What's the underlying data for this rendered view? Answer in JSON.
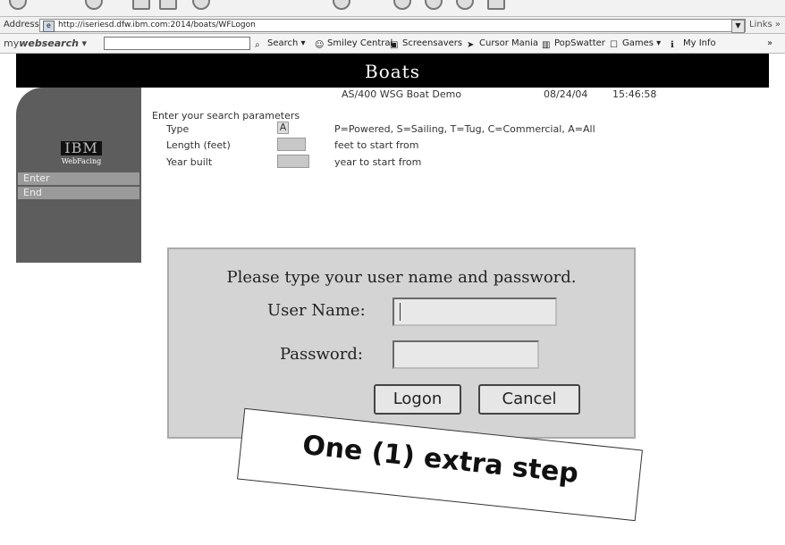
{
  "browser": {
    "address_label": "Address",
    "url": "http://iseriesd.dfw.ibm.com:2014/boats/WFLogon",
    "links_label": "Links",
    "search_brand_my": "my",
    "search_brand_web": "websearch",
    "toolbar": {
      "search": "Search",
      "smiley": "Smiley Central",
      "screensavers": "Screensavers",
      "cursor": "Cursor Mania",
      "popswatter": "PopSwatter",
      "games": "Games",
      "myinfo": "My Info"
    }
  },
  "app": {
    "title": "Boats",
    "subtitle": "AS/400 WSG Boat Demo",
    "date": "08/24/04",
    "time": "15:46:58",
    "logo_top": "IBM",
    "logo_bottom": "WebFacing",
    "nav": {
      "enter": "Enter",
      "end": "End"
    },
    "form": {
      "heading": "Enter your search parameters",
      "type_label": "Type",
      "type_value": "A",
      "type_hint": "P=Powered, S=Sailing, T=Tug, C=Commercial, A=All",
      "length_label": "Length (feet)",
      "length_hint": "feet to start from",
      "year_label": "Year built",
      "year_hint": "year to start from"
    }
  },
  "logon": {
    "prompt": "Please type your user name and password.",
    "username_label": "User Name:",
    "password_label": "Password:",
    "logon_button": "Logon",
    "cancel_button": "Cancel"
  },
  "caption": "One (1) extra step"
}
